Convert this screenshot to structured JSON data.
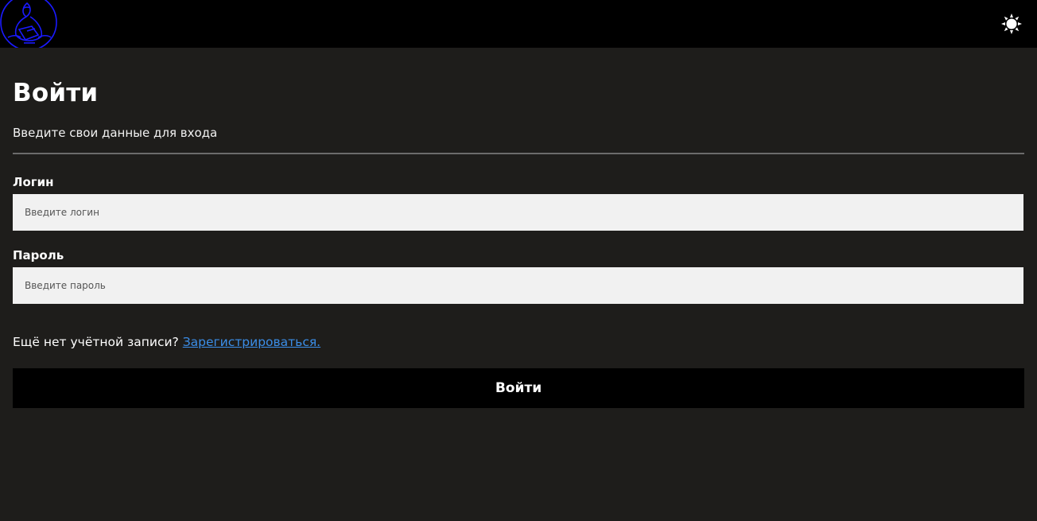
{
  "header": {
    "logo_icon": "hooded-figure-logo",
    "logo_color": "#1a1aff",
    "theme_toggle_icon": "sun-icon"
  },
  "login": {
    "title": "Войти",
    "subtitle": "Введите свои данные для входа",
    "fields": {
      "login": {
        "label": "Логин",
        "placeholder": "Введите логин",
        "value": ""
      },
      "password": {
        "label": "Пароль",
        "placeholder": "Введите пароль",
        "value": ""
      }
    },
    "register_prompt": "Ещё нет учётной записи?",
    "register_link": "Зарегистрироваться.",
    "submit_label": "Войти"
  },
  "colors": {
    "background": "#1e1d1b",
    "header": "#000000",
    "link": "#3b8ee8",
    "input_background": "#f1f1f1"
  }
}
